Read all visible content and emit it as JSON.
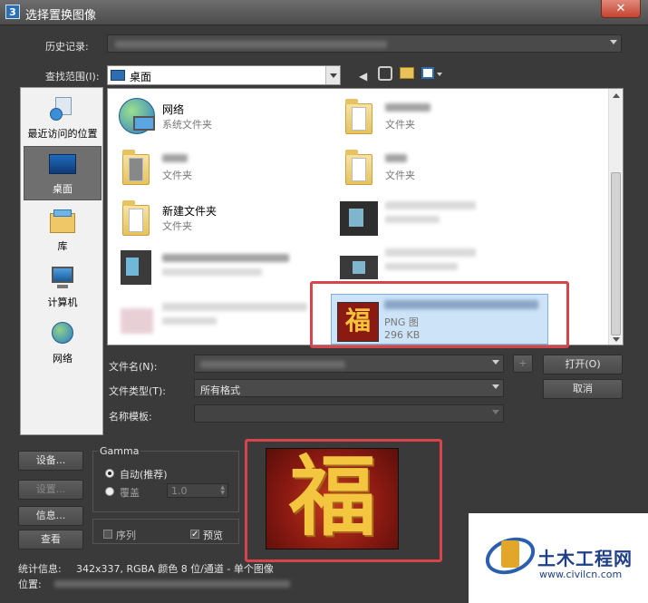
{
  "window": {
    "title": "选择置换图像",
    "app_icon": "3",
    "close": "✕"
  },
  "history": {
    "label": "历史记录:"
  },
  "lookin": {
    "label": "查找范围(I):",
    "value": "桌面"
  },
  "places": [
    {
      "label": "最近访问的位置",
      "icon": "recent-places-icon"
    },
    {
      "label": "桌面",
      "icon": "desktop-icon"
    },
    {
      "label": "库",
      "icon": "library-icon"
    },
    {
      "label": "计算机",
      "icon": "computer-icon"
    },
    {
      "label": "网络",
      "icon": "network-icon"
    }
  ],
  "files": [
    {
      "name": "网络",
      "type": "系统文件夹"
    },
    {
      "name": "",
      "type": "文件夹"
    },
    {
      "name": "",
      "type": "文件夹"
    },
    {
      "name": "",
      "type": "文件夹"
    },
    {
      "name": "新建文件夹",
      "type": "文件夹"
    },
    {
      "name": "",
      "type": "PNG 图",
      "size": "296 KB"
    }
  ],
  "filename": {
    "label": "文件名(N):"
  },
  "filetype": {
    "label": "文件类型(T):",
    "value": "所有格式"
  },
  "template": {
    "label": "名称模板:"
  },
  "buttons": {
    "plus": "+",
    "open": "打开(O)",
    "cancel": "取消",
    "setup": "设备...",
    "settings": "设置...",
    "info": "信息...",
    "view": "查看"
  },
  "gamma": {
    "label": "Gamma",
    "auto": "自动(推荐)",
    "override": "覆盖",
    "override_value": "1.0"
  },
  "options": {
    "sequence": "序列",
    "preview": "预览"
  },
  "stats": {
    "label": "统计信息:",
    "value": "342x337, RGBA 颜色 8 位/通道 - 单个图像"
  },
  "location": {
    "label": "位置:"
  },
  "watermark": {
    "brand": "土木工程网",
    "url": "www.civilcn.com"
  },
  "colors": {
    "highlight": "#d6454b",
    "selection": "#cde3f7"
  }
}
